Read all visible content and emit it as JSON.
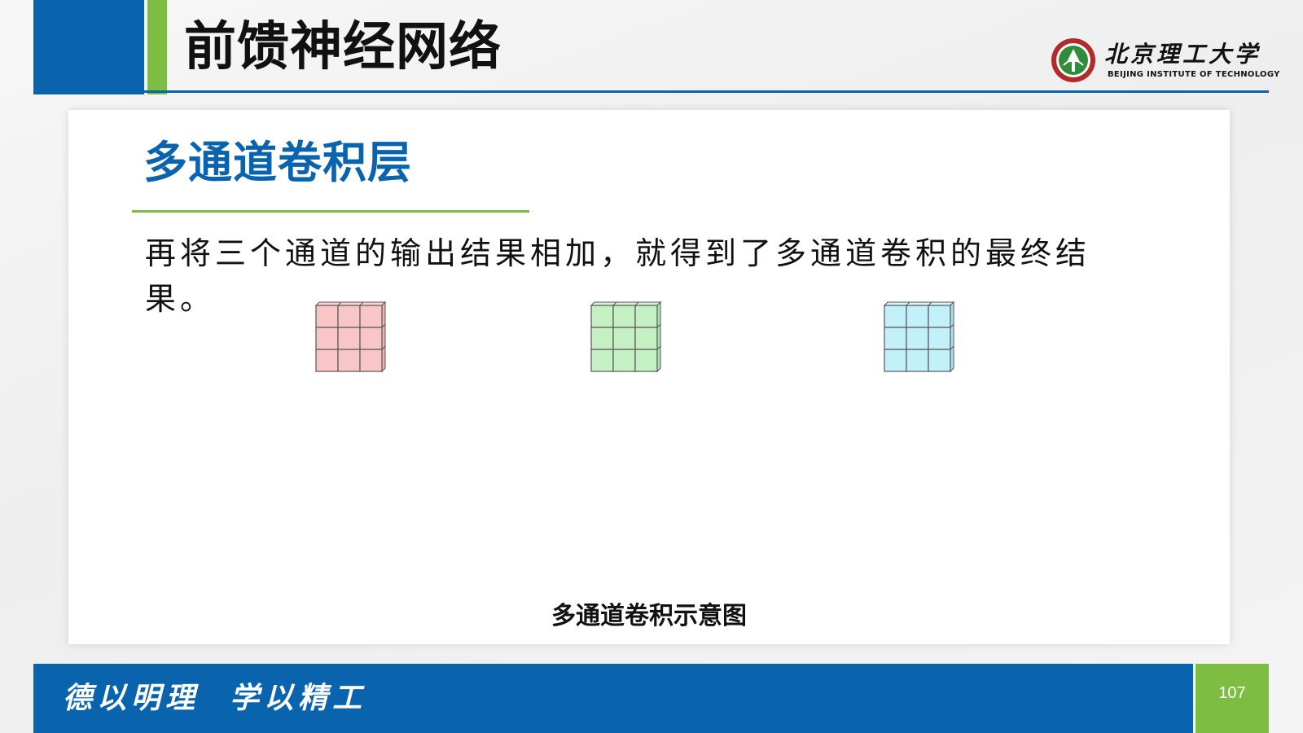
{
  "header": {
    "title": "前馈神经网络",
    "logo_cn": "北京理工大学",
    "logo_en": "BEIJING INSTITUTE OF TECHNOLOGY"
  },
  "content": {
    "section_title": "多通道卷积层",
    "body": "再将三个通道的输出结果相加，就得到了多通道卷积的最终结果。",
    "caption": "多通道卷积示意图",
    "grids": [
      {
        "name": "pink",
        "fill": "#f8c6c6",
        "top": "#f9d6d6",
        "side": "#f2b0b0"
      },
      {
        "name": "green",
        "fill": "#c5f0c4",
        "top": "#d6f5d5",
        "side": "#aee6ac"
      },
      {
        "name": "cyan",
        "fill": "#c3f1fa",
        "top": "#d6f6fc",
        "side": "#a8e6f2"
      }
    ]
  },
  "footer": {
    "motto": "德以明理  学以精工",
    "page_number": "107"
  },
  "colors": {
    "brand_blue": "#0a64ad",
    "brand_green": "#7dbd42"
  }
}
